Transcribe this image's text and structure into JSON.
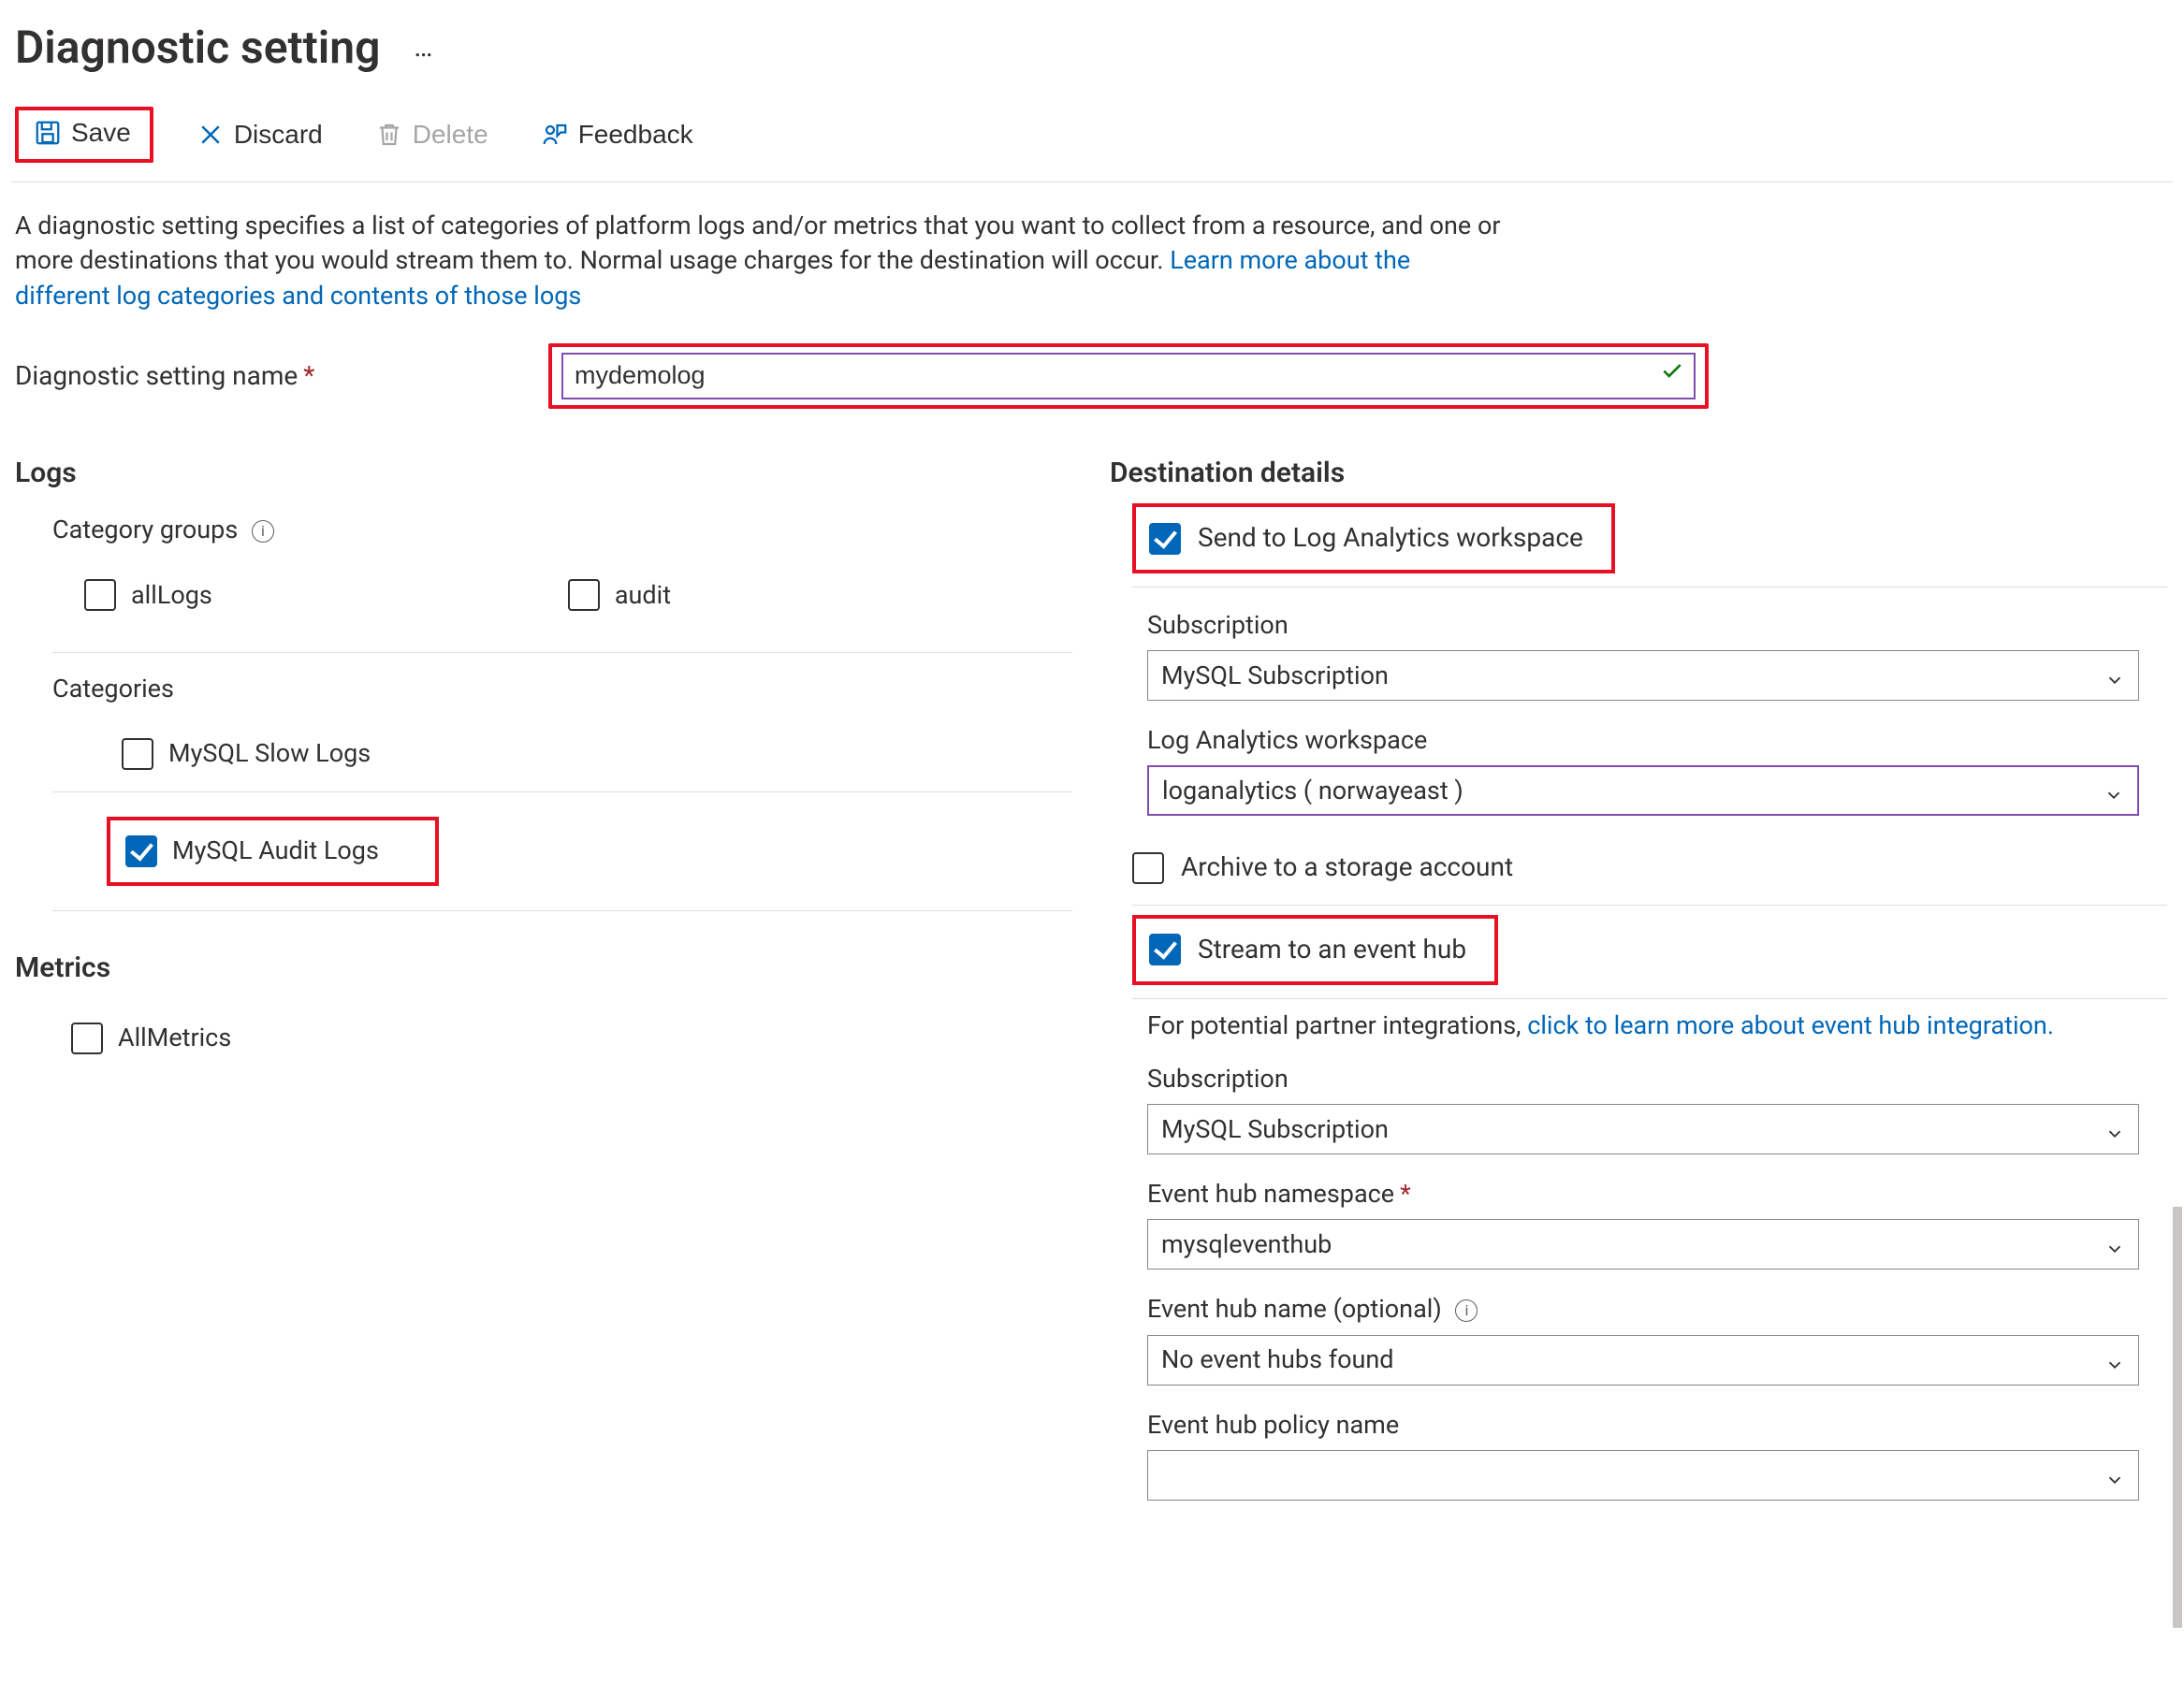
{
  "page": {
    "title": "Diagnostic setting",
    "more_glyph": "…"
  },
  "toolbar": {
    "save_label": "Save",
    "discard_label": "Discard",
    "delete_label": "Delete",
    "feedback_label": "Feedback"
  },
  "intro": {
    "text_part1": "A diagnostic setting specifies a list of categories of platform logs and/or metrics that you want to collect from a resource, and one or more destinations that you would stream them to. Normal usage charges for the destination will occur. ",
    "link_text": "Learn more about the different log categories and contents of those logs"
  },
  "form": {
    "name_label": "Diagnostic setting name",
    "name_value": "mydemolog"
  },
  "logs": {
    "heading": "Logs",
    "category_groups_label": "Category groups",
    "allLogs_label": "allLogs",
    "audit_label": "audit",
    "categories_label": "Categories",
    "slow_logs_label": "MySQL Slow Logs",
    "audit_logs_label": "MySQL Audit Logs"
  },
  "metrics": {
    "heading": "Metrics",
    "allmetrics_label": "AllMetrics"
  },
  "dest": {
    "heading": "Destination details",
    "law_label": "Send to Log Analytics workspace",
    "subscription_label": "Subscription",
    "subscription_value": "MySQL Subscription",
    "law_field_label": "Log Analytics workspace",
    "law_value": "loganalytics ( norwayeast )",
    "archive_label": "Archive to a storage account",
    "stream_label": "Stream to an event hub",
    "partner_text": "For potential partner integrations, ",
    "partner_link": "click to learn more about event hub integration.",
    "eh_subscription_label": "Subscription",
    "eh_subscription_value": "MySQL Subscription",
    "eh_namespace_label": "Event hub namespace",
    "eh_namespace_value": "mysqleventhub",
    "eh_name_label": "Event hub name (optional)",
    "eh_name_value": "No event hubs found",
    "eh_policy_label": "Event hub policy name",
    "eh_policy_value": ""
  }
}
